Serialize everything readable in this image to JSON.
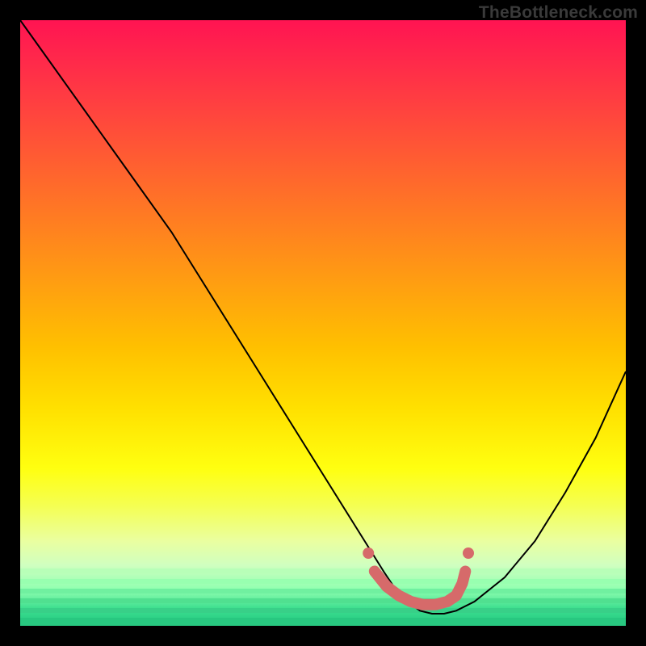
{
  "watermark": "TheBottleneck.com",
  "chart_data": {
    "type": "line",
    "title": "",
    "xlabel": "",
    "ylabel": "",
    "xlim": [
      0,
      100
    ],
    "ylim": [
      0,
      100
    ],
    "series": [
      {
        "name": "main-curve",
        "color": "#000000",
        "width": 2,
        "x": [
          0,
          5,
          10,
          15,
          20,
          25,
          30,
          35,
          40,
          45,
          50,
          55,
          60,
          62,
          64,
          66,
          68,
          70,
          72,
          75,
          80,
          85,
          90,
          95,
          100
        ],
        "y": [
          100,
          93,
          86,
          79,
          72,
          65,
          57,
          49,
          41,
          33,
          25,
          17,
          9,
          6,
          4,
          2.5,
          2,
          2,
          2.5,
          4,
          8,
          14,
          22,
          31,
          42
        ]
      },
      {
        "name": "optimum-markers",
        "color": "#d66a6a",
        "type": "scatter_line",
        "x": [
          58.5,
          60.5,
          62.5,
          64.5,
          66.5,
          68.5,
          70.5,
          72.0,
          73.0,
          73.5
        ],
        "y": [
          9.0,
          6.5,
          5.0,
          4.0,
          3.5,
          3.5,
          4.0,
          5.0,
          7.0,
          9.0
        ]
      }
    ],
    "gradient_stops": [
      {
        "pos": 0.0,
        "color": "#ff1452"
      },
      {
        "pos": 0.07,
        "color": "#ff2a4a"
      },
      {
        "pos": 0.14,
        "color": "#ff4040"
      },
      {
        "pos": 0.24,
        "color": "#ff6030"
      },
      {
        "pos": 0.34,
        "color": "#ff8020"
      },
      {
        "pos": 0.44,
        "color": "#ffa010"
      },
      {
        "pos": 0.54,
        "color": "#ffc000"
      },
      {
        "pos": 0.64,
        "color": "#ffe000"
      },
      {
        "pos": 0.74,
        "color": "#ffff10"
      },
      {
        "pos": 0.8,
        "color": "#f5ff50"
      },
      {
        "pos": 0.86,
        "color": "#eaffa0"
      },
      {
        "pos": 0.9,
        "color": "#d0ffc0"
      },
      {
        "pos": 0.94,
        "color": "#90ffb0"
      },
      {
        "pos": 0.97,
        "color": "#40e090"
      },
      {
        "pos": 1.0,
        "color": "#20c880"
      }
    ],
    "green_bands": [
      {
        "top_pct": 90.5,
        "height_pct": 0.8,
        "color": "#b8ffb8"
      },
      {
        "top_pct": 92.2,
        "height_pct": 0.8,
        "color": "#98ffb0"
      },
      {
        "top_pct": 93.8,
        "height_pct": 0.8,
        "color": "#70f0a0"
      },
      {
        "top_pct": 95.4,
        "height_pct": 0.8,
        "color": "#50e090"
      },
      {
        "top_pct": 97.0,
        "height_pct": 0.8,
        "color": "#38d088"
      },
      {
        "top_pct": 98.6,
        "height_pct": 1.4,
        "color": "#28c880"
      }
    ]
  }
}
